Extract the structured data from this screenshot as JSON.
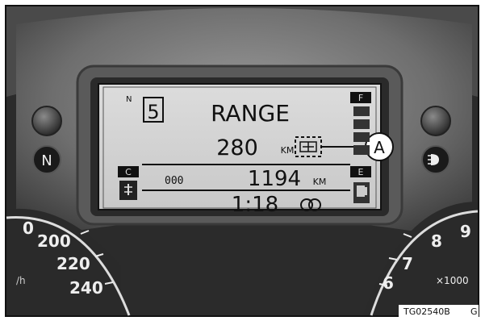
{
  "display": {
    "gear_prefix": "N",
    "gear_number": "5",
    "mode_label": "RANGE",
    "range_value": "280",
    "range_unit": "KM",
    "odometer_prefix": "000",
    "odometer_value": "1194",
    "odometer_unit": "KM",
    "clock": "1:18",
    "fuel_full_label": "F",
    "fuel_empty_label": "E",
    "temp_cold_label": "C"
  },
  "indicators": {
    "left_neutral_label": "N",
    "right_headlight_icon": "headlight-icon"
  },
  "callout": {
    "label": "A"
  },
  "speedometer": {
    "ticks": [
      "200",
      "220",
      "240"
    ],
    "unit_fragment": "/h"
  },
  "tachometer": {
    "ticks": [
      "9",
      "8",
      "7",
      "6"
    ],
    "multiplier_label": "×1000"
  },
  "figure": {
    "code": "TG02540B",
    "suffix": "G"
  },
  "colors": {
    "lcd_background": "#d4d4d4",
    "lcd_text": "#111111",
    "bezel": "#6b6b6b",
    "frame": "#111111"
  }
}
